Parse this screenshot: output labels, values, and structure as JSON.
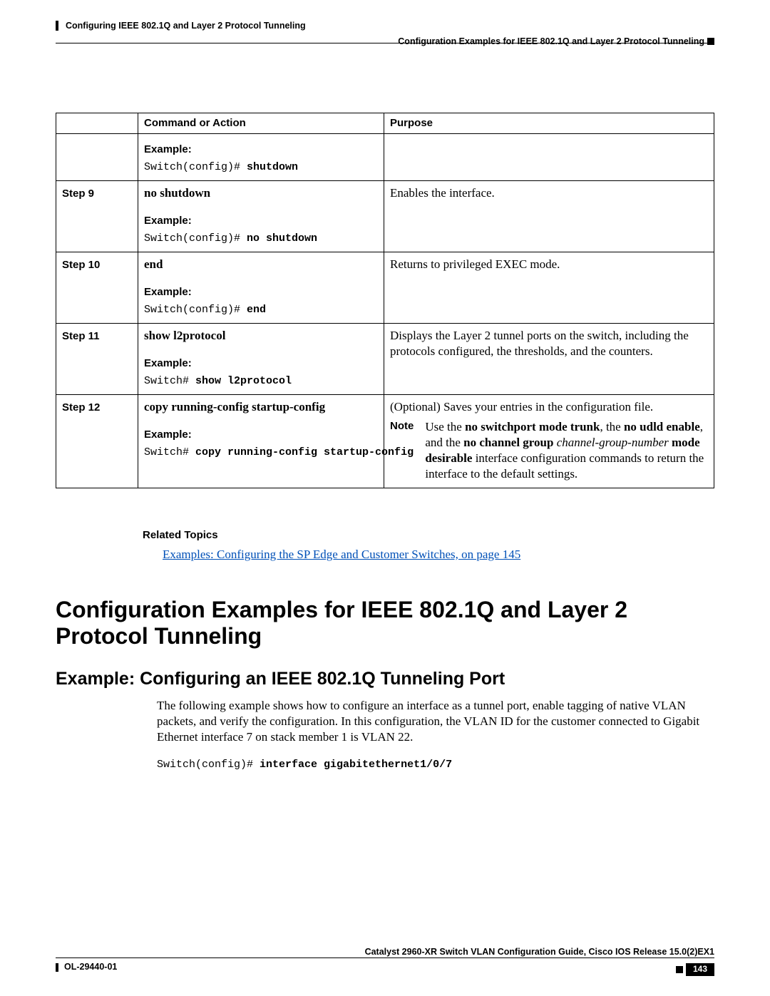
{
  "header": {
    "chapter": "Configuring IEEE 802.1Q and Layer 2 Protocol Tunneling",
    "section": "Configuration Examples for IEEE 802.1Q and Layer 2 Protocol Tunneling"
  },
  "table": {
    "headers": {
      "col1": "",
      "col2": "Command or Action",
      "col3": "Purpose"
    },
    "rows": [
      {
        "step": "",
        "command": {
          "main": "",
          "example_label": "Example:",
          "code_prefix": "Switch(config)# ",
          "code_cmd": "shutdown"
        },
        "purpose": {
          "text": ""
        }
      },
      {
        "step": "Step 9",
        "command": {
          "main": "no shutdown",
          "example_label": "Example:",
          "code_prefix": "Switch(config)# ",
          "code_cmd": "no shutdown"
        },
        "purpose": {
          "text": "Enables the interface."
        }
      },
      {
        "step": "Step 10",
        "command": {
          "main": "end",
          "example_label": "Example:",
          "code_prefix": "Switch(config)# ",
          "code_cmd": "end"
        },
        "purpose": {
          "text": "Returns to privileged EXEC mode."
        }
      },
      {
        "step": "Step 11",
        "command": {
          "main": "show l2protocol",
          "example_label": "Example:",
          "code_prefix": "Switch# ",
          "code_cmd": "show l2protocol"
        },
        "purpose": {
          "text": "Displays the Layer 2 tunnel ports on the switch, including the protocols configured, the thresholds, and the counters."
        }
      },
      {
        "step": "Step 12",
        "command": {
          "main": "copy running-config startup-config",
          "example_label": "Example:",
          "code_prefix": "Switch# ",
          "code_cmd": "copy running-config startup-config"
        },
        "purpose": {
          "text": "(Optional) Saves your entries in the configuration file.",
          "note_label": "Note",
          "note_pre1": "Use the ",
          "note_b1": "no switchport mode trunk",
          "note_mid1": ", the ",
          "note_b2": "no udld enable",
          "note_mid2": ", and the ",
          "note_b3": "no channel group",
          "note_space": " ",
          "note_i1": "channel-group-number",
          "note_space2": " ",
          "note_b4": "mode desirable",
          "note_post": " interface configuration commands to return the interface to the default settings."
        }
      }
    ]
  },
  "related": {
    "title": "Related Topics",
    "link": "Examples: Configuring the SP Edge and Customer Switches,  on page 145"
  },
  "h1": "Configuration Examples for IEEE 802.1Q and Layer 2 Protocol Tunneling",
  "h2": "Example: Configuring an IEEE 802.1Q Tunneling Port",
  "para": "The following example shows how to configure an interface as a tunnel port, enable tagging of native VLAN packets, and verify the configuration. In this configuration, the VLAN ID for the customer connected to Gigabit Ethernet interface 7 on stack member 1 is VLAN 22.",
  "codeline": {
    "prefix": "Switch(config)# ",
    "cmd": "interface gigabitethernet1/0/7"
  },
  "footer": {
    "guide": "Catalyst 2960-XR Switch VLAN Configuration Guide, Cisco IOS Release 15.0(2)EX1",
    "docid": "OL-29440-01",
    "page": "143"
  }
}
